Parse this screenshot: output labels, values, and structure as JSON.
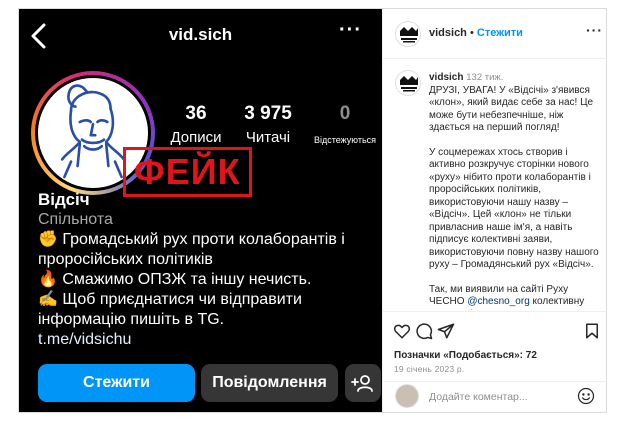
{
  "profile": {
    "username": "vid.sich",
    "stamp_text": "ФЕЙК",
    "stats": [
      {
        "value": "36",
        "label": "Дописи"
      },
      {
        "value": "3 975",
        "label": "Читачі"
      },
      {
        "value": "0",
        "label": "Відстежуються"
      }
    ],
    "name": "Відсіч",
    "category": "Спільнота",
    "bio_lines": [
      "✊ Громадський рух проти колаборантів і",
      "проросійських політиків",
      "🔥 Смажимо ОПЗЖ та іншу нечисть.",
      "✍️ Щоб приєднатися чи відправити",
      "інформацію пишіть в TG."
    ],
    "link": "t.me/vidsichu",
    "follow_label": "Стежити",
    "message_label": "Повідомлення"
  },
  "post": {
    "header_username": "vidsich",
    "header_separator": "•",
    "header_follow": "Стежити",
    "comment_username": "vidsich",
    "comment_age": "132 тиж.",
    "paragraphs": [
      "ДРУЗІ, УВАГА! У «Відсічі» з'явився «клон», який видає себе за нас! Це може бути небезпечніше, ніж здається на перший погляд!",
      "У соцмережах хтось створив і активно розкручує сторінки нового «руху» нібито проти колаборантів і проросійських політиків, використовуючи нашу назву – «Відсіч». Цей «клон» не тільки привласнив наше ім'я, а навіть підписує колективні заяви, використовуючи повну назву нашого руху – Громадянський рух «Відсіч»."
    ],
    "p3_before": "Так, ми виявили на сайті Руху ЧЕСНО ",
    "p3_mention": "@chesno_org",
    "p3_after": " колективну заяву з підписом Громадянського руху «Відсіч», але з посиланням на",
    "likes_text": "Позначки «Подобається»: 72",
    "date_text": "19 січень 2023 р.",
    "add_comment_placeholder": "Додайте коментар..."
  },
  "colors": {
    "accent_blue": "#0095f6",
    "stamp_red": "#e0151b",
    "dark_button": "#363636"
  },
  "icons": [
    "back-arrow-icon",
    "more-icon",
    "add-person-icon",
    "heart-icon",
    "comment-icon",
    "share-icon",
    "bookmark-icon",
    "emoji-icon"
  ]
}
